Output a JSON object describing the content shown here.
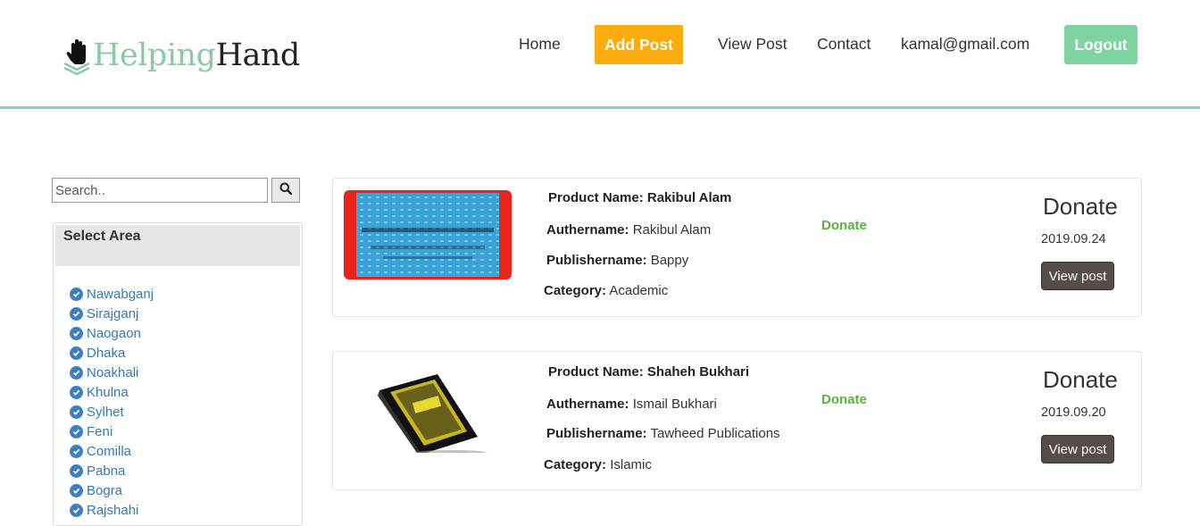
{
  "brand": {
    "part1": "Helping",
    "part2": "Hand"
  },
  "nav": {
    "home": "Home",
    "add_post": "Add Post",
    "view_post": "View Post",
    "contact": "Contact",
    "user_email": "kamal@gmail.com",
    "logout": "Logout"
  },
  "colors": {
    "accent_green": "#7fd3a2",
    "add_post_orange": "#fbac0e",
    "donate_green": "#5cb23c",
    "link_blue": "#337ab7"
  },
  "search": {
    "placeholder": "Search..",
    "value": ""
  },
  "areas": {
    "title": "Select Area",
    "items": [
      "Nawabganj",
      "Sirajganj",
      "Naogaon",
      "Dhaka",
      "Noakhali",
      "Khulna",
      "Sylhet",
      "Feni",
      "Comilla",
      "Pabna",
      "Bogra",
      "Rajshahi"
    ]
  },
  "labels": {
    "product_name": "Product Name:",
    "author": "Authername:",
    "publisher": "Publishername:",
    "category": "Category:"
  },
  "posts": [
    {
      "product_name": "Rakibul Alam",
      "author": "Rakibul Alam",
      "publisher": "Bappy",
      "category": "Academic",
      "donate_link": "Donate",
      "donate_title": "Donate",
      "date": "2019.09.24",
      "view_label": "View post",
      "image_icon": "book-cover-applied-english-grammar",
      "book_cover_text": "Applied English Grammar and Composition"
    },
    {
      "product_name": "Shaheh Bukhari",
      "author": "Ismail Bukhari",
      "publisher": "Tawheed Publications",
      "category": "Islamic",
      "donate_link": "Donate",
      "donate_title": "Donate",
      "date": "2019.09.20",
      "view_label": "View post",
      "image_icon": "book-cover-bukhari"
    }
  ]
}
